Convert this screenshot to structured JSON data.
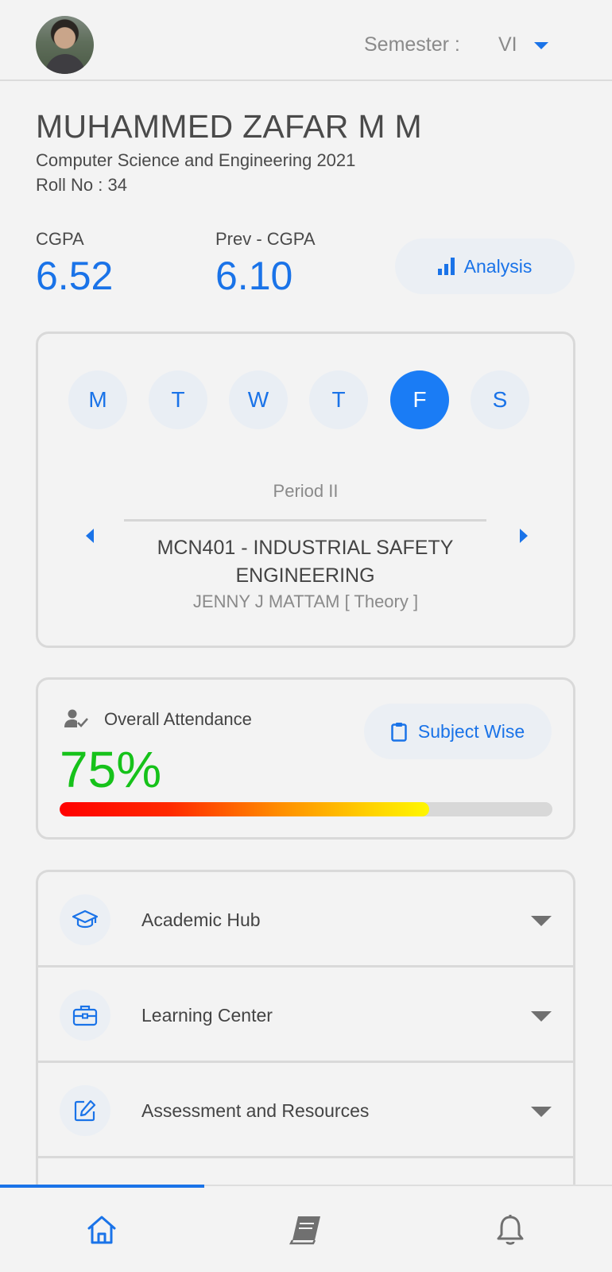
{
  "header": {
    "semester_label": "Semester :",
    "semester_value": "VI"
  },
  "profile": {
    "name": "MUHAMMED ZAFAR M M",
    "department": "Computer Science and Engineering 2021",
    "roll": "Roll No : 34"
  },
  "grades": {
    "cgpa_label": "CGPA",
    "cgpa_value": "6.52",
    "prev_label": "Prev - CGPA",
    "prev_value": "6.10",
    "analysis_label": "Analysis"
  },
  "timetable": {
    "days": [
      "M",
      "T",
      "W",
      "T",
      "F",
      "S"
    ],
    "active_day_index": 4,
    "period": "Period II",
    "subject": "MCN401 - INDUSTRIAL SAFETY ENGINEERING",
    "teacher": "JENNY J MATTAM [ Theory ]"
  },
  "attendance": {
    "title": "Overall Attendance",
    "value": "75%",
    "fraction": 0.75,
    "subject_wise_label": "Subject Wise",
    "colors": {
      "value": "#16c21a",
      "bar_start": "#ff0000",
      "bar_end": "#fff700"
    }
  },
  "menu": {
    "items": [
      {
        "label": "Academic Hub",
        "icon": "graduation-cap-icon"
      },
      {
        "label": "Learning Center",
        "icon": "briefcase-icon"
      },
      {
        "label": "Assessment and Resources",
        "icon": "edit-icon"
      }
    ]
  },
  "bottom_nav": {
    "items": [
      "home-icon",
      "book-icon",
      "bell-icon"
    ],
    "active_index": 0
  },
  "colors": {
    "accent": "#1a73e8",
    "background": "#f3f3f3"
  }
}
